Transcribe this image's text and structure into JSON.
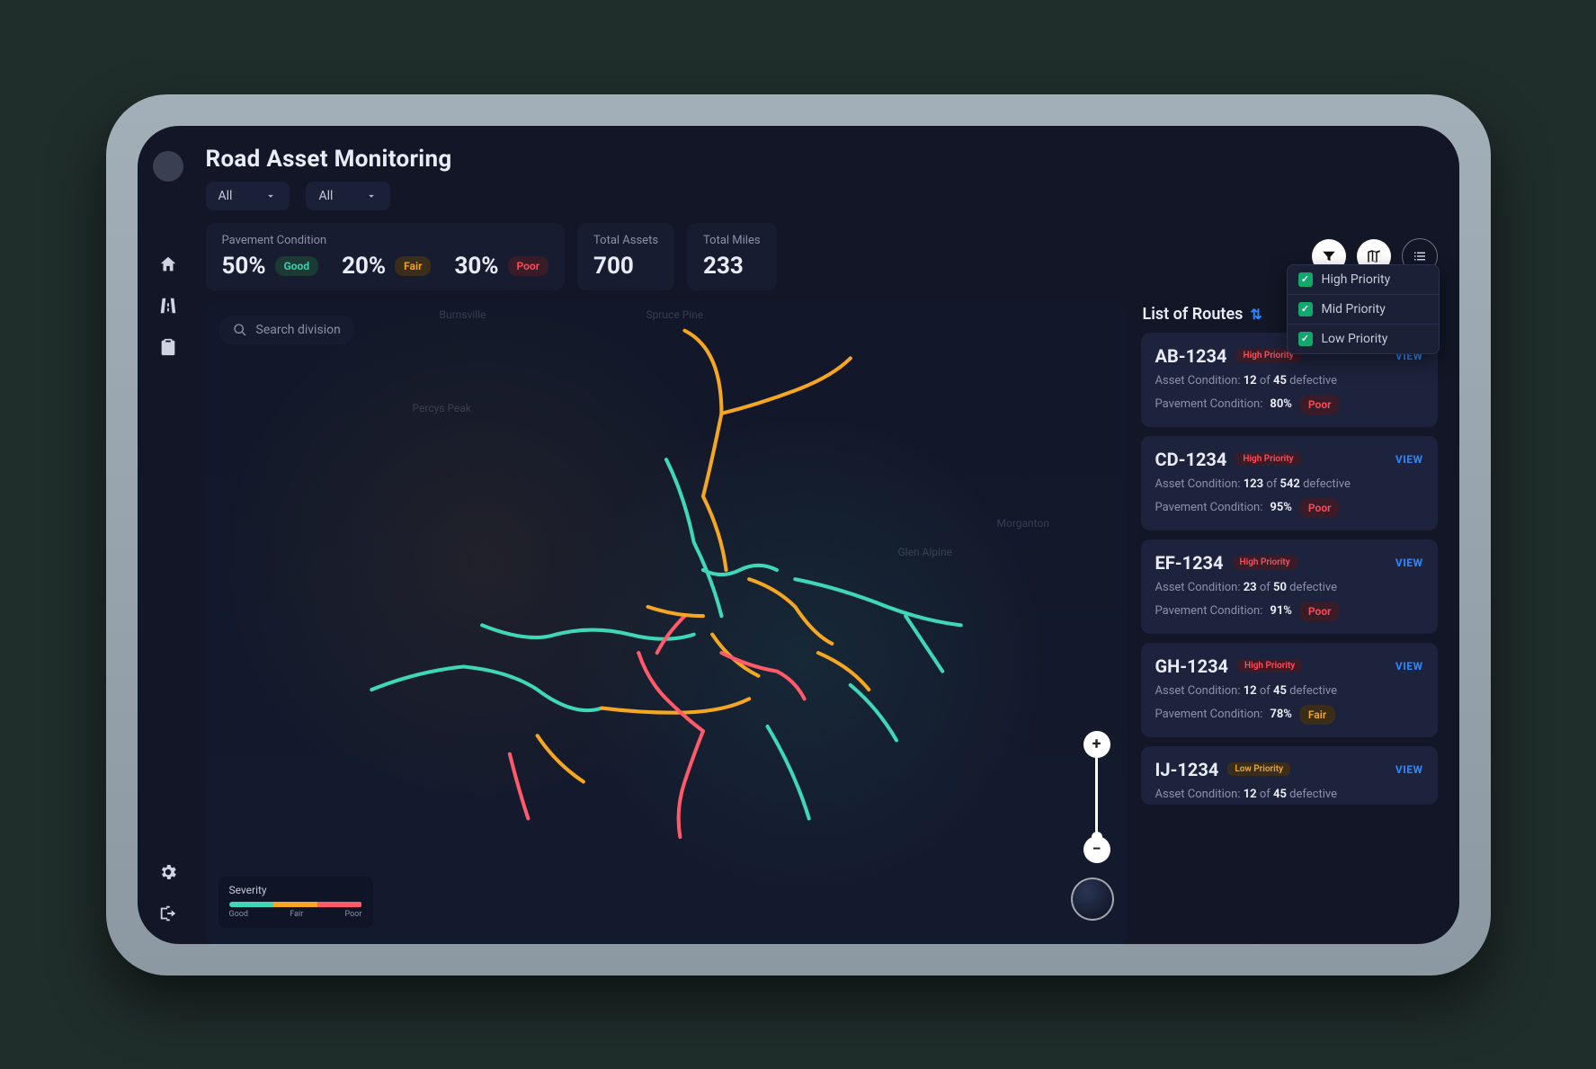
{
  "app": {
    "title": "Road Asset Monitoring"
  },
  "filters": {
    "dropdown1": "All",
    "dropdown2": "All"
  },
  "stats": {
    "pavement_label": "Pavement Condition",
    "good_pct": "50%",
    "good_label": "Good",
    "fair_pct": "20%",
    "fair_label": "Fair",
    "poor_pct": "30%",
    "poor_label": "Poor",
    "total_assets_label": "Total Assets",
    "total_assets": "700",
    "total_miles_label": "Total Miles",
    "total_miles": "233"
  },
  "priority_menu": {
    "high": "High Priority",
    "mid": "Mid Priority",
    "low": "Low Priority"
  },
  "map": {
    "search_placeholder": "Search division",
    "labels": {
      "burnsville": "Burnsville",
      "spruce_pine": "Spruce Pine",
      "percys_peak": "Percys Peak",
      "glen_alpine": "Glen Alpine",
      "morganton": "Morganton"
    },
    "legend": {
      "title": "Severity",
      "good": "Good",
      "fair": "Fair",
      "poor": "Poor"
    }
  },
  "routes": {
    "heading": "List of Routes",
    "view_label": "VIEW",
    "items": [
      {
        "id": "AB-1234",
        "priority": "High Priority",
        "priority_class": "high",
        "asset_label": "Asset Condition:",
        "asset_a": "12",
        "asset_of": "of",
        "asset_b": "45",
        "asset_tail": "defective",
        "pave_label": "Pavement Condition:",
        "pave_pct": "80%",
        "pave_status": "Poor",
        "pave_class": "poor"
      },
      {
        "id": "CD-1234",
        "priority": "High Priority",
        "priority_class": "high",
        "asset_label": "Asset Condition:",
        "asset_a": "123",
        "asset_of": "of",
        "asset_b": "542",
        "asset_tail": "defective",
        "pave_label": "Pavement Condition:",
        "pave_pct": "95%",
        "pave_status": "Poor",
        "pave_class": "poor"
      },
      {
        "id": "EF-1234",
        "priority": "High Priority",
        "priority_class": "high",
        "asset_label": "Asset Condition:",
        "asset_a": "23",
        "asset_of": "of",
        "asset_b": "50",
        "asset_tail": "defective",
        "pave_label": "Pavement Condition:",
        "pave_pct": "91%",
        "pave_status": "Poor",
        "pave_class": "poor"
      },
      {
        "id": "GH-1234",
        "priority": "High Priority",
        "priority_class": "high",
        "asset_label": "Asset Condition:",
        "asset_a": "12",
        "asset_of": "of",
        "asset_b": "45",
        "asset_tail": "defective",
        "pave_label": "Pavement Condition:",
        "pave_pct": "78%",
        "pave_status": "Fair",
        "pave_class": "fair"
      },
      {
        "id": "IJ-1234",
        "priority": "Low Priority",
        "priority_class": "low",
        "asset_label": "Asset Condition:",
        "asset_a": "12",
        "asset_of": "of",
        "asset_b": "45",
        "asset_tail": "defective",
        "pave_label": "",
        "pave_pct": "",
        "pave_status": "",
        "pave_class": ""
      }
    ]
  }
}
